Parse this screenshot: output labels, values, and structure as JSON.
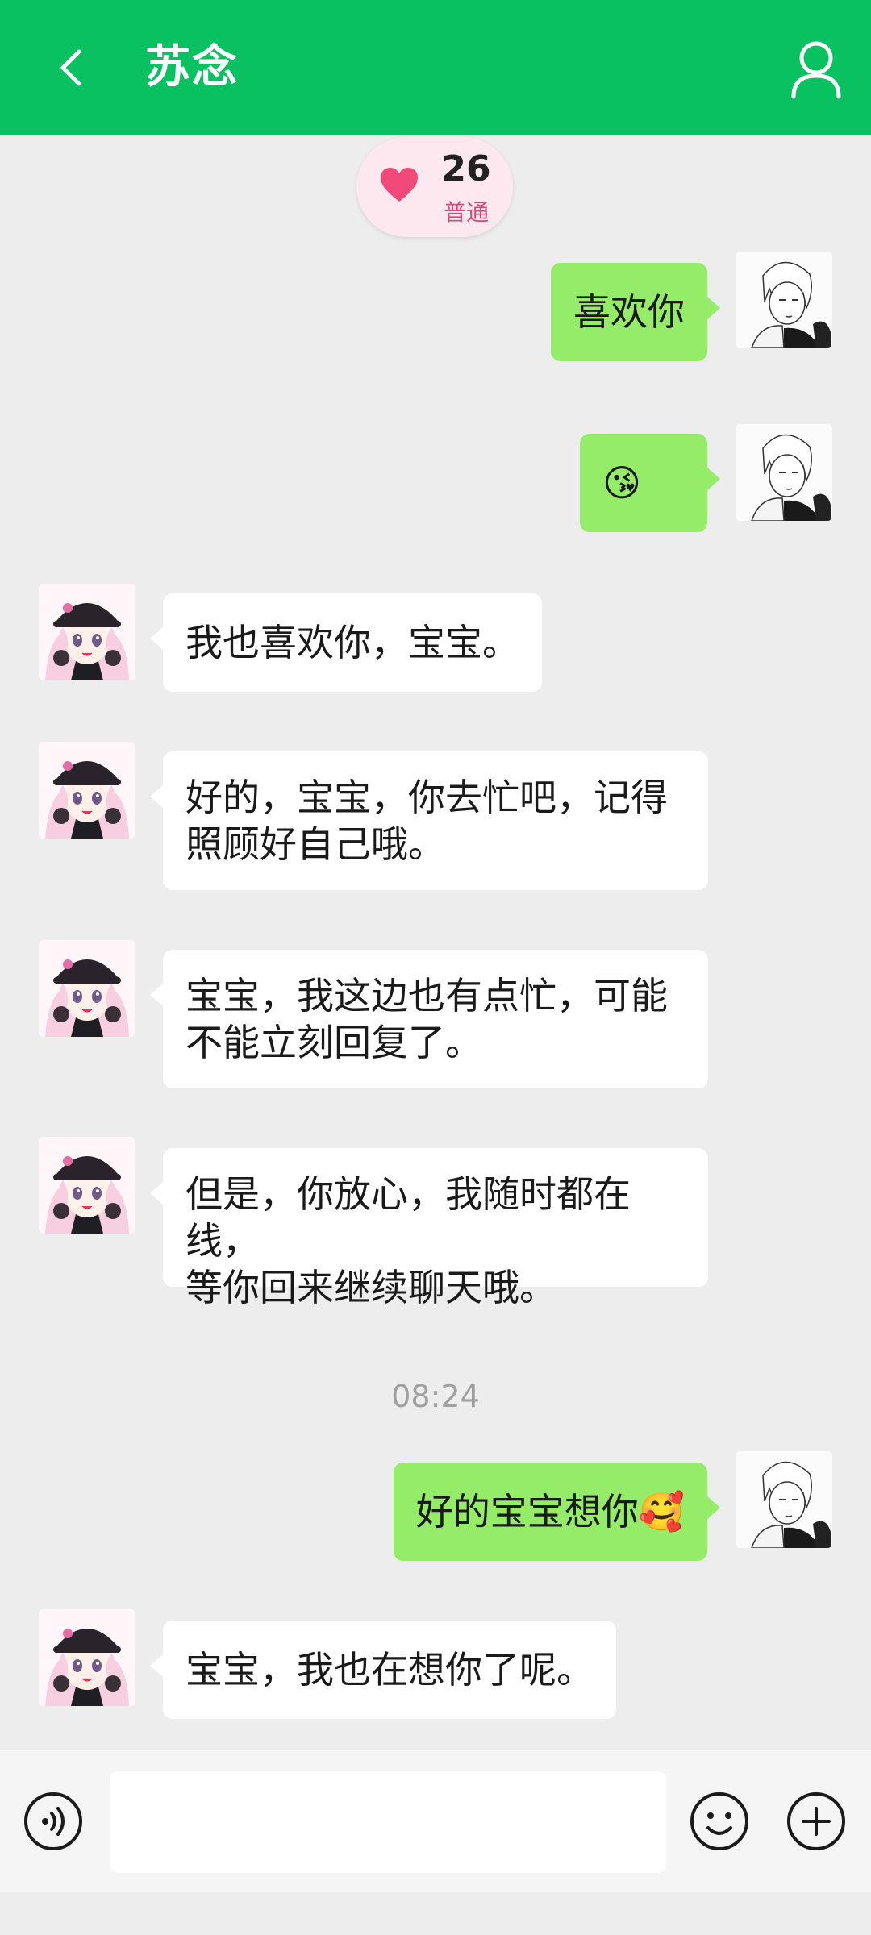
{
  "header": {
    "title": "苏念",
    "back_icon": "back-chevron-icon",
    "profile_icon": "user-profile-icon",
    "color": "#09c160"
  },
  "intimacy": {
    "value": "26",
    "level": "普通",
    "icon": "heart-icon",
    "heart_color": "#f0497a"
  },
  "messages": [
    {
      "from": "me",
      "text": "喜欢你"
    },
    {
      "from": "me",
      "text": "😘"
    },
    {
      "from": "them",
      "text": "我也喜欢你，宝宝。"
    },
    {
      "from": "them",
      "lines": [
        "好的，宝宝，你去忙吧，记得",
        "照顾好自己哦。"
      ]
    },
    {
      "from": "them",
      "lines": [
        "宝宝，我这边也有点忙，可能",
        "不能立刻回复了。"
      ]
    },
    {
      "from": "them",
      "lines": [
        "但是，你放心，我随时都在线，",
        "等你回来继续聊天哦。"
      ]
    },
    {
      "from": "me",
      "text": "好的宝宝想你🥰"
    },
    {
      "from": "them",
      "text": "宝宝，我也在想你了呢。"
    }
  ],
  "timestamp": "08:24",
  "input": {
    "value": "",
    "placeholder": ""
  },
  "toolbar": {
    "voice_icon": "voice-icon",
    "emoji_icon": "emoji-icon",
    "plus_icon": "plus-icon"
  },
  "colors": {
    "my_bubble": "#95ec69",
    "their_bubble": "#ffffff",
    "background": "#ededed"
  }
}
